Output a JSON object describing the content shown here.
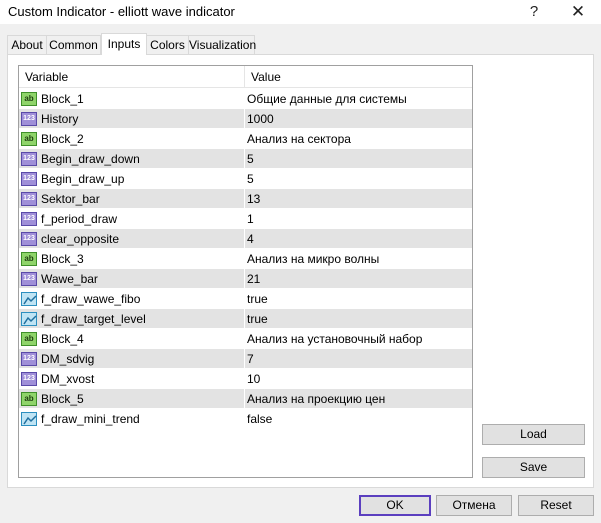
{
  "window": {
    "title": "Custom Indicator - elliott wave indicator",
    "help_glyph": "?",
    "close_glyph": "✕"
  },
  "tabs": [
    {
      "label": "About"
    },
    {
      "label": "Common"
    },
    {
      "label": "Inputs"
    },
    {
      "label": "Colors"
    },
    {
      "label": "Visualization"
    }
  ],
  "active_tab": "Inputs",
  "grid": {
    "header_variable": "Variable",
    "header_value": "Value",
    "icon_labels": {
      "string": "ab",
      "int": "123"
    },
    "rows": [
      {
        "type": "string",
        "name": "Block_1",
        "value": "Общие данные для системы"
      },
      {
        "type": "int",
        "name": "History",
        "value": "1000"
      },
      {
        "type": "string",
        "name": "Block_2",
        "value": "Анализ на сектора"
      },
      {
        "type": "int",
        "name": "Begin_draw_down",
        "value": "5"
      },
      {
        "type": "int",
        "name": "Begin_draw_up",
        "value": "5"
      },
      {
        "type": "int",
        "name": "Sektor_bar",
        "value": "13"
      },
      {
        "type": "int",
        "name": "f_period_draw",
        "value": "1"
      },
      {
        "type": "int",
        "name": "clear_opposite",
        "value": "4"
      },
      {
        "type": "string",
        "name": "Block_3",
        "value": "Анализ на микро волны"
      },
      {
        "type": "int",
        "name": "Wawe_bar",
        "value": "21"
      },
      {
        "type": "bool",
        "name": "f_draw_wawe_fibo",
        "value": "true"
      },
      {
        "type": "bool",
        "name": "f_draw_target_level",
        "value": "true"
      },
      {
        "type": "string",
        "name": "Block_4",
        "value": "Анализ на установочный набор"
      },
      {
        "type": "int",
        "name": "DM_sdvig",
        "value": "7"
      },
      {
        "type": "int",
        "name": "DM_xvost",
        "value": "10"
      },
      {
        "type": "string",
        "name": "Block_5",
        "value": "Анализ на проекцию цен"
      },
      {
        "type": "bool",
        "name": "f_draw_mini_trend",
        "value": "false"
      }
    ]
  },
  "buttons": {
    "load": "Load",
    "save": "Save",
    "ok": "OK",
    "cancel": "Отмена",
    "reset": "Reset"
  },
  "colors": {
    "ok_border": "#5b3fbf",
    "row_alt": "#e3e3e3",
    "string_icon": "#8fd46a",
    "int_icon": "#9f8fd8",
    "bool_icon": "#bfe4f4"
  }
}
